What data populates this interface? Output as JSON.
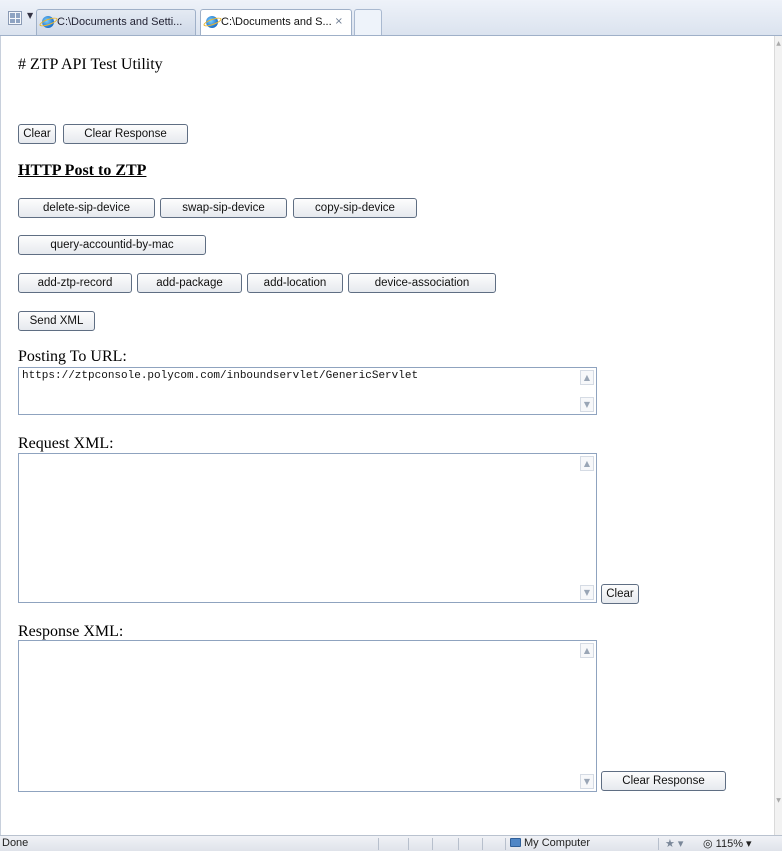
{
  "tabs": [
    {
      "label": "C:\\Documents and Setti...",
      "active": false
    },
    {
      "label": "C:\\Documents and S...",
      "active": true,
      "close": "×"
    }
  ],
  "page": {
    "heading": "# ZTP API Test Utility",
    "top_buttons": {
      "clear": "Clear",
      "clear_response": "Clear Response"
    },
    "section_title": "HTTP Post to ZTP",
    "buttons_row1": [
      "delete-sip-device",
      "swap-sip-device",
      "copy-sip-device"
    ],
    "buttons_row2": [
      "query-accountid-by-mac"
    ],
    "buttons_row3": [
      "add-ztp-record",
      "add-package",
      "add-location",
      "device-association"
    ],
    "send_xml": "Send XML",
    "posting_label": "Posting To URL:",
    "posting_url": "https://ztpconsole.polycom.com/inboundservlet/GenericServlet",
    "request_label": "Request XML:",
    "request_value": "",
    "request_clear": "Clear",
    "response_label": "Response XML:",
    "response_value": "",
    "response_clear": "Clear Response"
  },
  "statusbar": {
    "status": "Done",
    "zone": "My Computer",
    "protected_mode": "★ ▾",
    "zoom": "◎ 115%  ▾"
  },
  "icons": {
    "quick_tabs": "quick-tabs-icon",
    "tab_list": "tab-list-arrow-icon",
    "ie_page": "ie-page-icon",
    "zone": "computer-zone-icon"
  }
}
